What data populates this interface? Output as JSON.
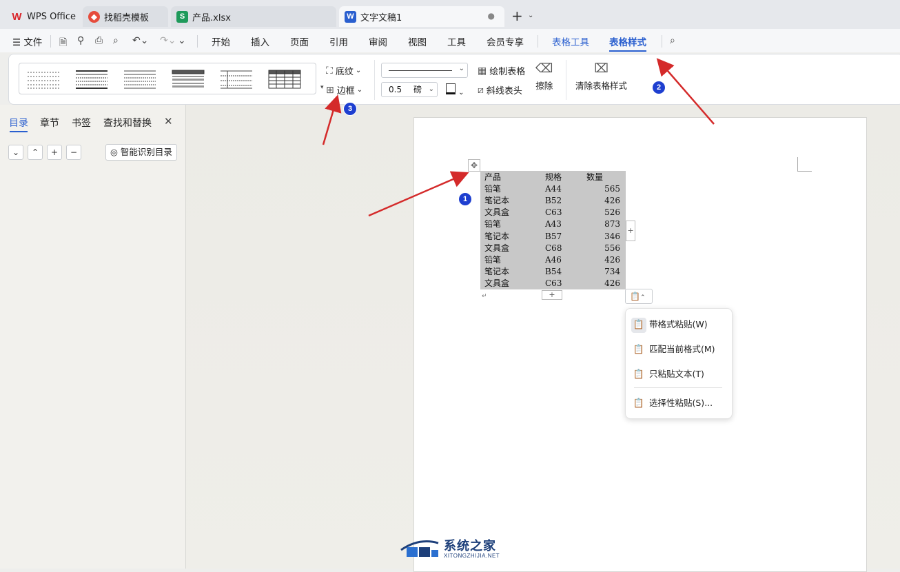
{
  "tabs": [
    {
      "label": "WPS Office",
      "icon": "wps-logo-icon",
      "color": "#d9262b"
    },
    {
      "label": "找稻壳模板",
      "icon": "docer-icon",
      "color": "#e64c3c"
    },
    {
      "label": "产品.xlsx",
      "icon": "sheet-icon",
      "badge": "S",
      "color": "#1f9a5b"
    },
    {
      "label": "文字文稿1",
      "icon": "writer-icon",
      "badge": "W",
      "color": "#2a5fcf",
      "active": true
    }
  ],
  "menu": {
    "file": "文件",
    "items": [
      "开始",
      "插入",
      "页面",
      "引用",
      "审阅",
      "视图",
      "工具",
      "会员专享"
    ],
    "table_tools": "表格工具",
    "table_style": "表格样式"
  },
  "ribbon": {
    "shading": "底纹",
    "border": "边框",
    "line_width": "0.5",
    "line_unit": "磅",
    "draw_table": "绘制表格",
    "diagonal_header": "斜线表头",
    "erase": "擦除",
    "clear_style": "清除表格样式"
  },
  "nav": {
    "tabs": [
      "目录",
      "章节",
      "书签",
      "查找和替换"
    ],
    "smart_toc": "智能识别目录"
  },
  "table": {
    "headers": [
      "产品",
      "规格",
      "数量"
    ],
    "rows": [
      [
        "铅笔",
        "A44",
        "565"
      ],
      [
        "笔记本",
        "B52",
        "426"
      ],
      [
        "文具盒",
        "C63",
        "526"
      ],
      [
        "铅笔",
        "A43",
        "873"
      ],
      [
        "笔记本",
        "B57",
        "346"
      ],
      [
        "文具盒",
        "C68",
        "556"
      ],
      [
        "铅笔",
        "A46",
        "426"
      ],
      [
        "笔记本",
        "B54",
        "734"
      ],
      [
        "文具盒",
        "C63",
        "426"
      ]
    ]
  },
  "paste_menu": [
    {
      "label": "带格式粘贴(W)",
      "icon": "paste-format-icon",
      "selected": true
    },
    {
      "label": "匹配当前格式(M)",
      "icon": "paste-match-icon"
    },
    {
      "label": "只粘贴文本(T)",
      "icon": "paste-text-icon"
    },
    {
      "label": "选择性粘贴(S)...",
      "icon": "paste-special-icon"
    }
  ],
  "annotations": [
    "1",
    "2",
    "3"
  ],
  "watermark": {
    "title": "系统之家",
    "subtitle": "XITONGZHIJIA.NET"
  },
  "colors": {
    "accent": "#2a5fcf",
    "arrow": "#d42a2a",
    "badge": "#1e3fd0",
    "selection": "#c8c8c8"
  }
}
